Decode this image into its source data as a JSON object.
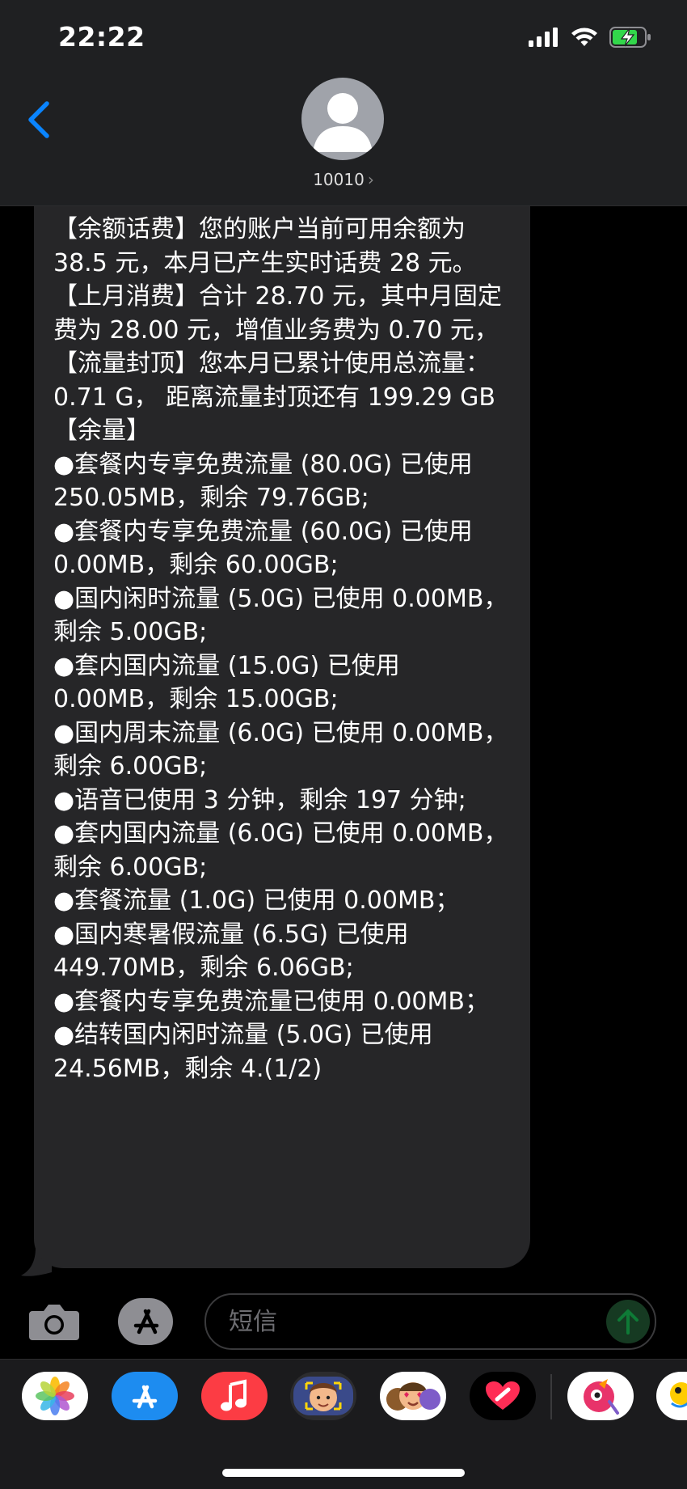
{
  "status_bar": {
    "time": "22:22"
  },
  "header": {
    "contact_name": "10010",
    "contact_arrow": "›"
  },
  "message": {
    "lines": [
      "【余额话费】您的账户当前可用余额为 38.5 元，本月已产生实时话费 28 元。",
      "【上月消费】合计 28.70 元，其中月固定费为 28.00 元，增值业务费为 0.70 元，",
      "【流量封顶】您本月已累计使用总流量：0.71 G， 距离流量封顶还有 199.29 GB",
      "【余量】",
      "●套餐内专享免费流量 (80.0G) 已使用 250.05MB，剩余 79.76GB;",
      "●套餐内专享免费流量 (60.0G) 已使用 0.00MB，剩余 60.00GB;",
      "●国内闲时流量 (5.0G) 已使用 0.00MB，剩余 5.00GB;",
      "●套内国内流量 (15.0G) 已使用 0.00MB，剩余 15.00GB;",
      "●国内周末流量 (6.0G) 已使用 0.00MB，剩余 6.00GB;",
      "●语音已使用 3 分钟，剩余 197 分钟;",
      "●套内国内流量 (6.0G) 已使用 0.00MB，剩余 6.00GB;",
      "●套餐流量 (1.0G) 已使用 0.00MB；",
      "●国内寒暑假流量 (6.5G) 已使用 449.70MB，剩余 6.06GB;",
      "●套餐内专享免费流量已使用 0.00MB；",
      "●结转国内闲时流量 (5.0G) 已使用 24.56MB，剩余 4.(1/2)"
    ]
  },
  "input_bar": {
    "placeholder": "短信"
  },
  "app_drawer": {
    "apps": [
      "photos-icon",
      "app-store-icon",
      "music-icon",
      "memoji-icon",
      "animoji-icon",
      "digital-touch-icon",
      "third-party-app-icon",
      "partial-app-icon"
    ]
  },
  "colors": {
    "accent_blue": "#0a84ff",
    "bubble_gray": "#262628",
    "header_bg": "#1f2022",
    "send_green": "#163a22"
  }
}
